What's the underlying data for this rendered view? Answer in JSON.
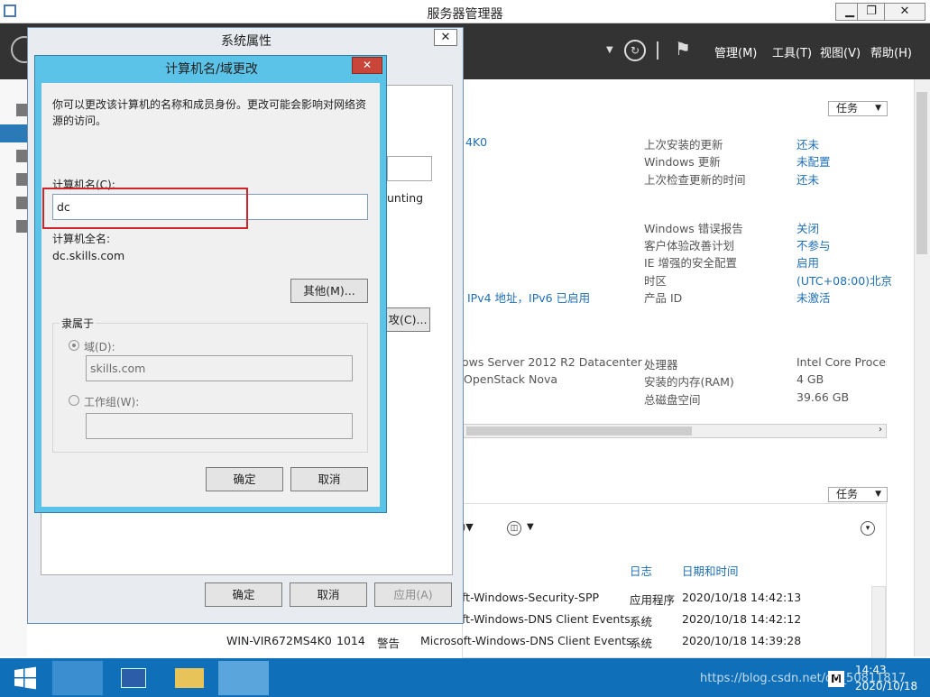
{
  "window": {
    "title": "服务器管理器",
    "min": "▁",
    "max": "❐",
    "close": "✕"
  },
  "menus": {
    "manage": "管理(M)",
    "tools": "工具(T)",
    "view": "视图(V)",
    "help": "帮助(H)"
  },
  "tasks": "任务",
  "content": {
    "computer_frag": "4K0",
    "update_rows": [
      [
        "上次安装的更新",
        "还未"
      ],
      [
        "Windows 更新",
        "未配置"
      ],
      [
        "上次检查更新的时间",
        "还未"
      ]
    ],
    "sec_rows": [
      [
        "Windows 错误报告",
        "关闭"
      ],
      [
        "客户体验改善计划",
        "不参与"
      ],
      [
        "IE 增强的安全配置",
        "启用"
      ],
      [
        "时区",
        "(UTC+08:00)北京"
      ],
      [
        "产品 ID",
        "未激活"
      ]
    ],
    "ipv4_frag": "IPv4 地址，IPv6 已启用",
    "counting_frag": "unting",
    "change_frag": "攻(C)...",
    "os_frag": "ows Server 2012 R2 Datacenter",
    "vendor_frag": "OpenStack Nova",
    "hw_rows": [
      [
        "处理器",
        "Intel Core Process"
      ],
      [
        "安装的内存(RAM)",
        "4 GB"
      ],
      [
        "总磁盘空间",
        "39.66 GB"
      ]
    ]
  },
  "events": {
    "col_log": "日志",
    "col_date": "日期和时间",
    "rows": [
      {
        "server": "",
        "id": "",
        "level": "",
        "source": "ft-Windows-Security-SPP",
        "log": "应用程序",
        "date": "2020/10/18 14:42:13"
      },
      {
        "server": "",
        "id": "",
        "level": "",
        "source": "ft-Windows-DNS Client Events",
        "log": "系统",
        "date": "2020/10/18 14:42:12"
      },
      {
        "server": "WIN-VIR672MS4K0",
        "id": "1014",
        "level": "警告",
        "source": "Microsoft-Windows-DNS Client Events",
        "log": "系统",
        "date": "2020/10/18 14:39:28"
      }
    ]
  },
  "sysprops": {
    "title": "系统属性",
    "ok": "确定",
    "cancel": "取消",
    "apply": "应用(A)"
  },
  "dialog": {
    "title": "计算机名/域更改",
    "desc": "你可以更改该计算机的名称和成员身份。更改可能会影响对网络资源的访问。",
    "computer_name_label": "计算机名(C):",
    "computer_name_value": "dc",
    "full_name_label": "计算机全名:",
    "full_name_value": "dc.skills.com",
    "more_button": "其他(M)...",
    "member_of": "隶属于",
    "domain_label": "域(D):",
    "domain_value": "skills.com",
    "workgroup_label": "工作组(W):",
    "ok": "确定",
    "cancel": "取消"
  },
  "clock": {
    "time": "14:43",
    "date": "2020/10/18"
  },
  "watermark": "https://blog.csdn.net/qq_50811817",
  "colors": {
    "highlight": "#d0242b",
    "link": "#1f6fb5",
    "taskbar": "#0f6fb8"
  }
}
